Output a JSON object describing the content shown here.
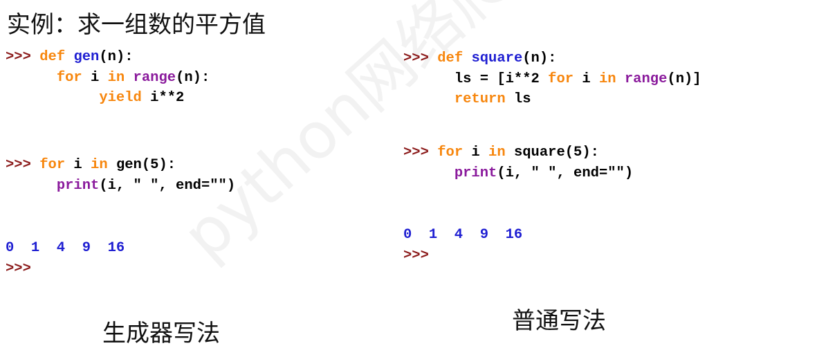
{
  "title": "实例：求一组数的平方值",
  "watermark": "python网络爬虫与信息提",
  "left": {
    "caption": "生成器写法",
    "prompt": ">>>",
    "def_kw": "def",
    "func_name": "gen",
    "def_args": "(n):",
    "for_kw": "for",
    "loop_var": " i ",
    "in_kw": "in",
    "range_bi": "range",
    "range_args": "(n):",
    "yield_kw": "yield",
    "yield_expr": " i**2",
    "call_var": " i ",
    "call_expr": " gen(5):",
    "print_bi": "print",
    "print_args": "(i, \" \", end=\"\")",
    "output": "0  1  4  9  16",
    "final_prompt": ">>>"
  },
  "right": {
    "caption": "普通写法",
    "prompt": ">>>",
    "def_kw": "def",
    "func_name": "square",
    "def_args": "(n):",
    "ls_pre": "ls = [i**2 ",
    "for_kw": "for",
    "loop_var": " i ",
    "in_kw": "in",
    "range_bi": "range",
    "range_args": "(n)]",
    "return_kw": "return",
    "return_val": " ls",
    "call_var": " i ",
    "call_expr": " square(5):",
    "print_bi": "print",
    "print_args": "(i, \" \", end=\"\")",
    "output": "0  1  4  9  16",
    "final_prompt": ">>>"
  }
}
